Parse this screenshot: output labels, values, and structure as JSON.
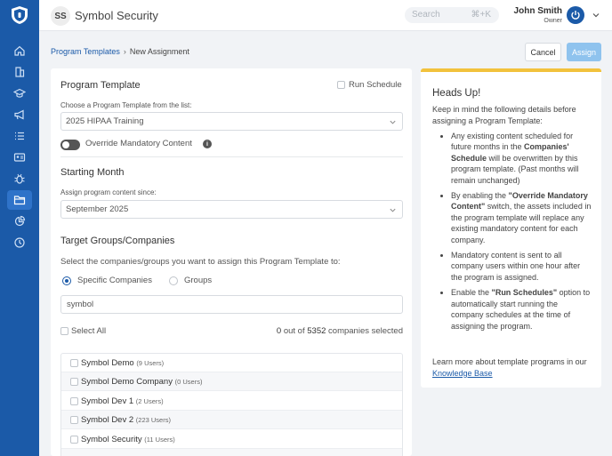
{
  "topbar": {
    "org_initials": "SS",
    "org_name": "Symbol Security",
    "search_placeholder": "Search",
    "search_shortcut": "⌘+K",
    "user_name": "John Smith",
    "user_role": "Owner"
  },
  "sidebar": {
    "items": [
      {
        "icon": "home-icon"
      },
      {
        "icon": "building-icon"
      },
      {
        "icon": "graduation-cap-icon"
      },
      {
        "icon": "megaphone-icon"
      },
      {
        "icon": "list-icon"
      },
      {
        "icon": "id-card-icon"
      },
      {
        "icon": "bug-icon"
      },
      {
        "icon": "folder-icon",
        "active": true
      },
      {
        "icon": "chart-pie-icon"
      },
      {
        "icon": "clock-icon"
      }
    ]
  },
  "breadcrumb": {
    "parent": "Program Templates",
    "separator": "›",
    "current": "New Assignment"
  },
  "actions": {
    "cancel": "Cancel",
    "assign": "Assign"
  },
  "form": {
    "program_template_title": "Program Template",
    "run_schedule_label": "Run Schedule",
    "choose_label": "Choose a Program Template from the list:",
    "template_value": "2025 HIPAA Training",
    "override_label": "Override Mandatory Content",
    "starting_month_title": "Starting Month",
    "assign_since_label": "Assign program content since:",
    "month_value": "September 2025",
    "target_title": "Target Groups/Companies",
    "target_desc": "Select the companies/groups you want to assign this Program Template to:",
    "radio_specific": "Specific Companies",
    "radio_groups": "Groups",
    "search_value": "symbol",
    "select_all": "Select All",
    "count_selected": "0",
    "count_out_of": "out of",
    "count_total": "5352",
    "count_suffix": "companies selected",
    "companies": [
      {
        "name": "Symbol Demo",
        "users": "(9 Users)"
      },
      {
        "name": "Symbol Demo Company",
        "users": "(0 Users)"
      },
      {
        "name": "Symbol Dev 1",
        "users": "(2 Users)"
      },
      {
        "name": "Symbol Dev 2",
        "users": "(223 Users)"
      },
      {
        "name": "Symbol Security",
        "users": "(11 Users)"
      }
    ]
  },
  "notice": {
    "title": "Heads Up!",
    "intro": "Keep in mind the following details before assigning a Program Template:",
    "b1_pre": "Any existing content scheduled for future months in the ",
    "b1_bold": "Companies' Schedule",
    "b1_post": " will be overwritten by this program template. (Past months will remain unchanged)",
    "b2_pre": "By enabling the ",
    "b2_bold": "\"Override Mandatory Content\"",
    "b2_post": " switch, the assets included in the program template will replace any existing mandatory content for each company.",
    "b3": "Mandatory content is sent to all company users within one hour after the program is assigned.",
    "b4_pre": "Enable the ",
    "b4_bold": "\"Run Schedules\"",
    "b4_post": " option to automatically start running the company schedules at the time of assigning the program.",
    "kb_pre": "Learn more about template programs in our ",
    "kb_link": "Knowledge Base"
  },
  "colors": {
    "sidebar": "#1b5aa8",
    "accent": "#1b5aa8",
    "assign_button": "#8fc3ee",
    "notice_border": "#f2c23c"
  }
}
